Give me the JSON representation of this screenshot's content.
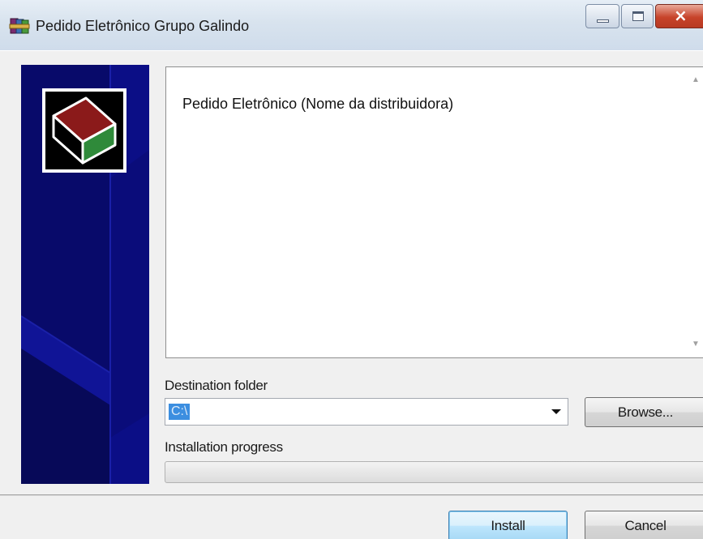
{
  "window": {
    "title": "Pedido Eletrônico Grupo Galindo",
    "icon": "archive-installer-icon",
    "controls": {
      "minimize": "minimize-icon",
      "maximize": "maximize-icon",
      "close": "×"
    }
  },
  "banner": {
    "logo": "book-logo-icon",
    "color": "#080a6a"
  },
  "readme": {
    "text": "Pedido Eletrônico (Nome da distribuidora)"
  },
  "destination": {
    "label": "Destination folder",
    "value": "C:\\"
  },
  "buttons": {
    "browse": "Browse...",
    "install": "Install",
    "cancel": "Cancel"
  },
  "progress": {
    "label": "Installation progress",
    "value": 0
  },
  "colors": {
    "accent": "#3c8ee0",
    "banner": "#080a6a",
    "close": "#c7432a"
  }
}
